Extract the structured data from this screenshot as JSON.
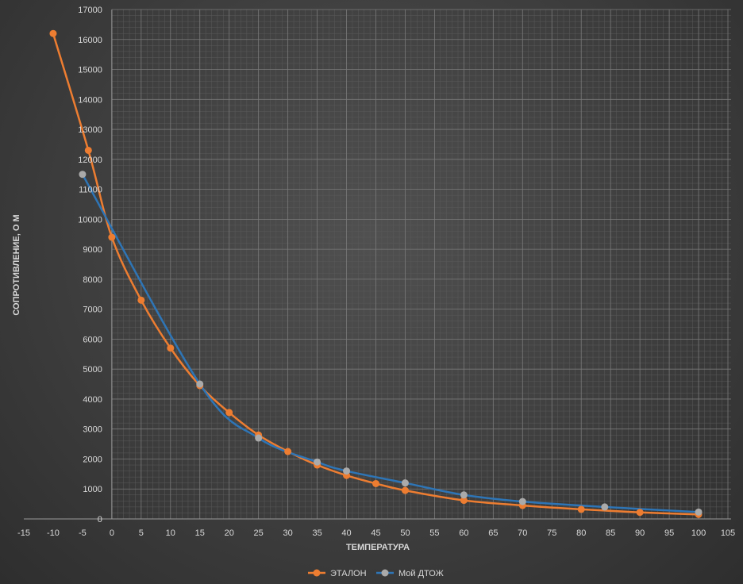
{
  "chart_data": {
    "type": "scatter",
    "title": "",
    "xlabel": "ТЕМПЕРАТУРА",
    "ylabel": "СОПРОТИВЛЕНИЕ, О М",
    "xlim": [
      -15,
      105
    ],
    "ylim": [
      0,
      17000
    ],
    "x_ticks": [
      -15,
      -10,
      -5,
      0,
      5,
      10,
      15,
      20,
      25,
      30,
      35,
      40,
      45,
      50,
      55,
      60,
      65,
      70,
      75,
      80,
      85,
      90,
      95,
      100,
      105
    ],
    "y_ticks": [
      0,
      1000,
      2000,
      3000,
      4000,
      5000,
      6000,
      7000,
      8000,
      9000,
      10000,
      11000,
      12000,
      13000,
      14000,
      15000,
      16000,
      17000
    ],
    "grid": true,
    "smooth_lines": true,
    "legend_position": "bottom",
    "series": [
      {
        "name": "ЭТАЛОН",
        "color": "#ed7d31",
        "x": [
          -10,
          -4,
          0,
          5,
          10,
          15,
          20,
          25,
          30,
          35,
          40,
          45,
          50,
          60,
          70,
          80,
          90,
          100
        ],
        "y": [
          16200,
          12300,
          9400,
          7300,
          5700,
          4450,
          3550,
          2800,
          2250,
          1800,
          1450,
          1180,
          950,
          620,
          450,
          320,
          220,
          150
        ]
      },
      {
        "name": "Мой ДТОЖ",
        "color": "#aaaaaa",
        "line_color": "#2e75b6",
        "x": [
          -5,
          15,
          25,
          35,
          40,
          50,
          60,
          70,
          84,
          100
        ],
        "y": [
          11500,
          4500,
          2700,
          1900,
          1600,
          1200,
          800,
          580,
          400,
          230
        ]
      }
    ]
  }
}
